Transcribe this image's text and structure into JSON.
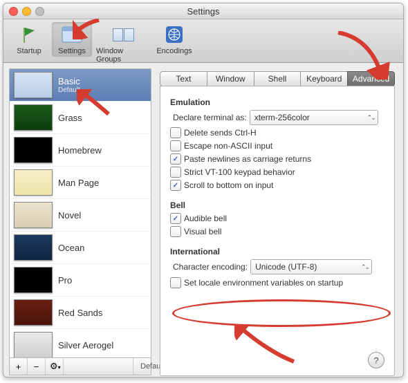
{
  "window": {
    "title": "Settings"
  },
  "toolbar": {
    "items": [
      {
        "label": "Startup"
      },
      {
        "label": "Settings"
      },
      {
        "label": "Window Groups"
      },
      {
        "label": "Encodings"
      }
    ]
  },
  "sidebar": {
    "profiles": [
      {
        "name": "Basic",
        "sub": "Default",
        "selected": true,
        "thumb": "basic"
      },
      {
        "name": "Grass",
        "thumb": "grass"
      },
      {
        "name": "Homebrew",
        "thumb": "homebrew"
      },
      {
        "name": "Man Page",
        "thumb": "manpage"
      },
      {
        "name": "Novel",
        "thumb": "novel"
      },
      {
        "name": "Ocean",
        "thumb": "ocean"
      },
      {
        "name": "Pro",
        "thumb": "pro"
      },
      {
        "name": "Red Sands",
        "thumb": "redsands"
      },
      {
        "name": "Silver Aerogel",
        "thumb": "silver"
      }
    ],
    "footer": {
      "add": "+",
      "remove": "−",
      "gear": "⚙",
      "default": "Default"
    }
  },
  "tabs": {
    "items": [
      "Text",
      "Window",
      "Shell",
      "Keyboard",
      "Advanced"
    ],
    "active": "Advanced"
  },
  "pane": {
    "emulation": {
      "title": "Emulation",
      "declare_label": "Declare terminal as:",
      "declare_value": "xterm-256color",
      "checkboxes": [
        {
          "label": "Delete sends Ctrl-H",
          "checked": false
        },
        {
          "label": "Escape non-ASCII input",
          "checked": false
        },
        {
          "label": "Paste newlines as carriage returns",
          "checked": true
        },
        {
          "label": "Strict VT-100 keypad behavior",
          "checked": false
        },
        {
          "label": "Scroll to bottom on input",
          "checked": true
        }
      ]
    },
    "bell": {
      "title": "Bell",
      "checkboxes": [
        {
          "label": "Audible bell",
          "checked": true
        },
        {
          "label": "Visual bell",
          "checked": false
        }
      ]
    },
    "international": {
      "title": "International",
      "encoding_label": "Character encoding:",
      "encoding_value": "Unicode (UTF-8)",
      "locale": {
        "label": "Set locale environment variables on startup",
        "checked": false
      }
    }
  },
  "help": "?"
}
